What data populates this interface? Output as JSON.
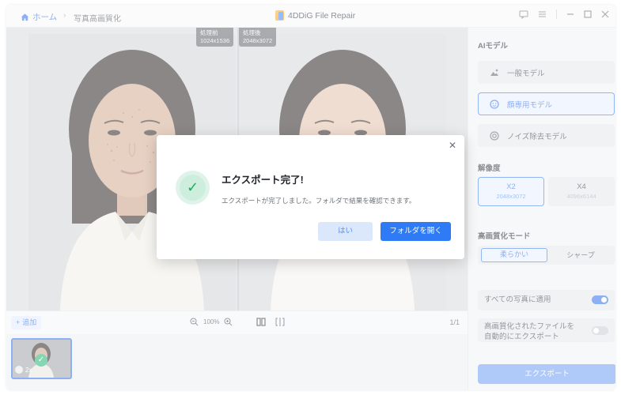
{
  "titlebar": {
    "home_label": "ホーム",
    "breadcrumb_current": "写真高画質化",
    "app_title": "4DDiG File Repair"
  },
  "preview": {
    "tag_before_label": "処理前",
    "tag_before_size": "1024x1536",
    "tag_after_label": "処理後",
    "tag_after_size": "2048x3072"
  },
  "toolbar": {
    "add_label": "追加",
    "zoom_value": "100%",
    "page": "1/1"
  },
  "thumbnail": {
    "scale_label": "2x"
  },
  "panel": {
    "ai_model_title": "AIモデル",
    "models": [
      {
        "label": "一般モデル",
        "icon": "landscape-icon",
        "active": false
      },
      {
        "label": "顔専用モデル",
        "icon": "face-icon",
        "active": true
      },
      {
        "label": "ノイズ除去モデル",
        "icon": "denoise-icon",
        "active": false
      }
    ],
    "resolution_title": "解像度",
    "resolutions": [
      {
        "label": "X2",
        "size": "2048x3072",
        "active": true
      },
      {
        "label": "X4",
        "size": "4096x6144",
        "active": false
      }
    ],
    "mode_title": "高画質化モード",
    "modes": [
      {
        "label": "柔らかい",
        "active": true
      },
      {
        "label": "シャープ",
        "active": false
      }
    ],
    "apply_all_label": "すべての写真に適用",
    "apply_all_on": true,
    "auto_export_line1": "高画質化されたファイルを",
    "auto_export_line2": "自動的にエクスポート",
    "auto_export_on": false,
    "export_label": "エクスポート"
  },
  "dialog": {
    "title": "エクスポート完了!",
    "message": "エクスポートが完了しました。フォルダで結果を確認できます。",
    "yes_label": "はい",
    "open_folder_label": "フォルダを開く"
  },
  "colors": {
    "accent": "#2f7bf5",
    "success": "#1faa64",
    "export_disabled": "#6e9ef3"
  }
}
